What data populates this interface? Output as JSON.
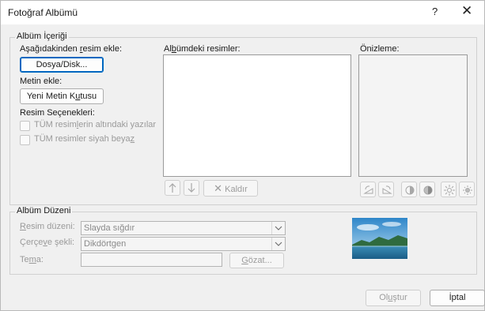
{
  "window": {
    "title": "Fotoğraf Albümü",
    "help": "?",
    "close": "✕"
  },
  "album_content": {
    "group_title": "Albüm İçeriği",
    "insert_from_label": "Aşağıdakinden resim ekle:",
    "file_disk_button": "Dosya/Disk...",
    "insert_text_label": "Metin ekle:",
    "new_text_box_button": "Yeni Metin Kutusu",
    "picture_options_label": "Resim Seçenekleri:",
    "captions_option": "TÜM resimlerin altındaki yazılar",
    "black_white_option": "TÜM resimler siyah beyaz",
    "pictures_in_album_label": "Albümdeki resimler:",
    "remove_button": "Kaldır",
    "preview_label": "Önizleme:"
  },
  "album_layout": {
    "group_title": "Albüm Düzeni",
    "picture_layout_label": "Resim düzeni:",
    "picture_layout_value": "Slayda sığdır",
    "frame_shape_label": "Çerçeve şekli:",
    "frame_shape_value": "Dikdörtgen",
    "theme_label": "Tema:",
    "browse_button": "Gözat..."
  },
  "footer": {
    "create_button": "Oluştur",
    "cancel_button": "İptal"
  },
  "colors": {
    "accent": "#0067c0",
    "dialog_bg": "#f0f0f0",
    "disabled_text": "#9a9a9a"
  },
  "icons": [
    "close-icon",
    "arrow-up-icon",
    "arrow-down-icon",
    "remove-x-icon",
    "rotate-left-icon",
    "rotate-right-icon",
    "contrast-up-icon",
    "contrast-down-icon",
    "brightness-up-icon",
    "brightness-down-icon",
    "chevron-down-icon"
  ]
}
